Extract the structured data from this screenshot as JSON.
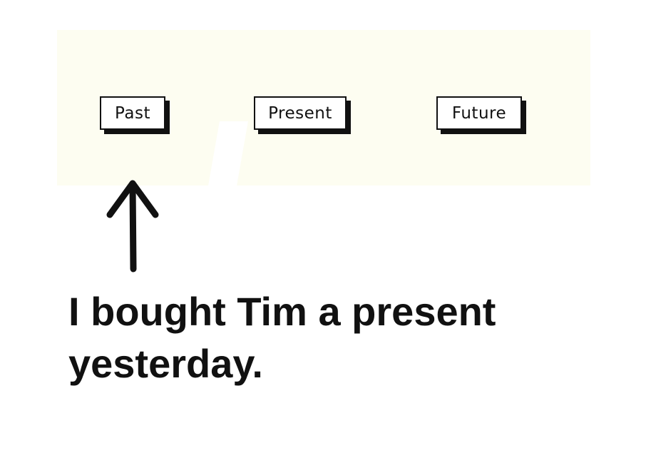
{
  "timeline": {
    "labels": [
      "Past",
      "Present",
      "Future"
    ]
  },
  "sentence": {
    "line1": "I bought Tim a present",
    "line2": "yesterday."
  },
  "colors": {
    "band": "#fdfdf1",
    "ink": "#111111",
    "background": "#ffffff"
  }
}
